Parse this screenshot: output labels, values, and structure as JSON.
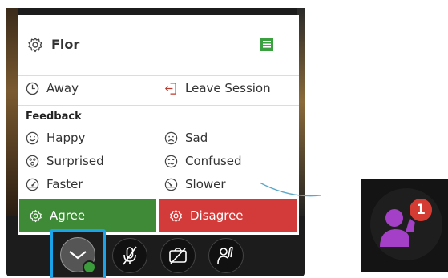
{
  "user": {
    "name": "Flor"
  },
  "status_menu": {
    "away_label": "Away",
    "leave_label": "Leave Session"
  },
  "feedback": {
    "title": "Feedback",
    "items": [
      {
        "label": "Happy",
        "icon": "happy-face-icon"
      },
      {
        "label": "Sad",
        "icon": "sad-face-icon"
      },
      {
        "label": "Surprised",
        "icon": "surprised-face-icon"
      },
      {
        "label": "Confused",
        "icon": "confused-face-icon"
      },
      {
        "label": "Faster",
        "icon": "faster-gauge-icon"
      },
      {
        "label": "Slower",
        "icon": "slower-gauge-icon"
      }
    ],
    "agree_label": "Agree",
    "disagree_label": "Disagree"
  },
  "raised_hand": {
    "count": "1"
  },
  "colors": {
    "agree": "#3f8a37",
    "disagree": "#d23b39",
    "selected_outline": "#1aa3e8",
    "hand_person": "#a43fc8",
    "badge": "#d43b32"
  }
}
